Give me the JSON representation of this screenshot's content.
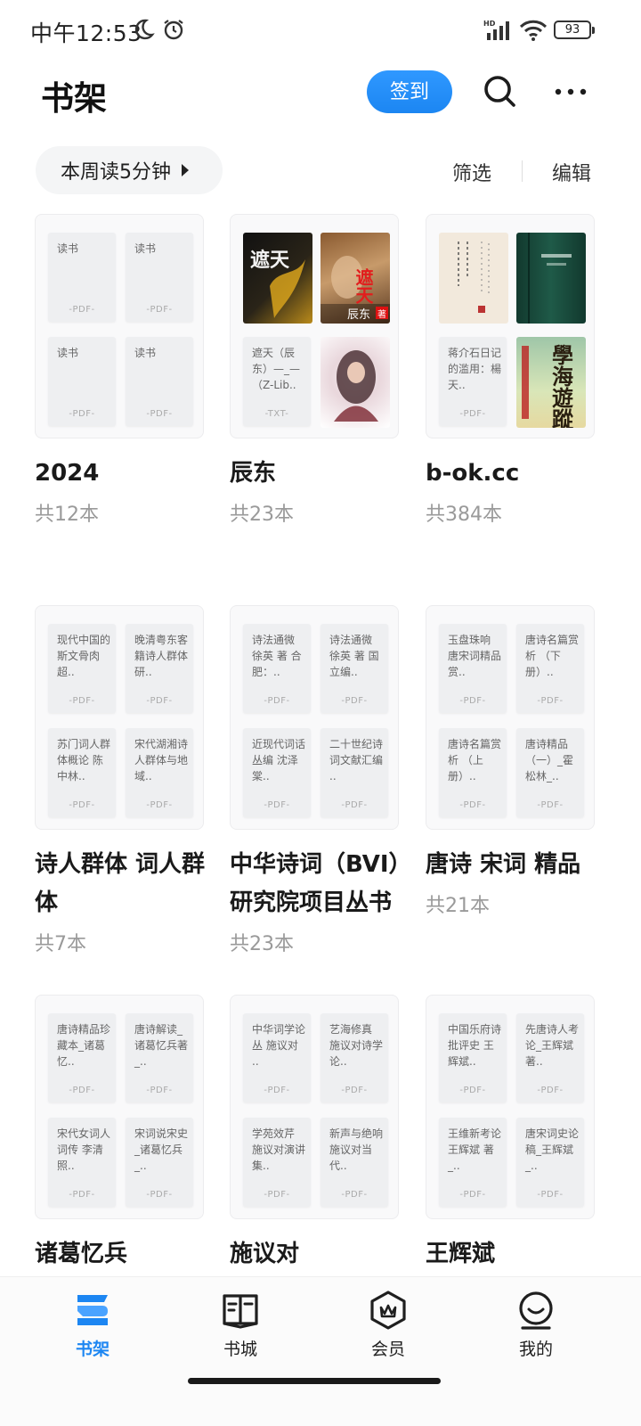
{
  "status_bar": {
    "time": "中午12:53",
    "battery": "93",
    "network_label": "HD"
  },
  "header": {
    "title": "书架",
    "signin_label": "签到"
  },
  "subheader": {
    "weekly_read": "本周读5分钟",
    "filter_label": "筛选",
    "edit_label": "编辑"
  },
  "folders": [
    {
      "name": "2024",
      "count": "共12本",
      "books": [
        {
          "title": "读书",
          "format": "-PDF-"
        },
        {
          "title": "读书",
          "format": "-PDF-"
        },
        {
          "title": "读书",
          "format": "-PDF-"
        },
        {
          "title": "读书",
          "format": "-PDF-"
        }
      ]
    },
    {
      "name": "辰东",
      "count": "共23本",
      "books": [
        {
          "title": "遮天",
          "format": ""
        },
        {
          "title": "遮天",
          "format": ""
        },
        {
          "title": "遮天（辰东）—_—（Z-Lib..",
          "format": "-TXT-"
        },
        {
          "title": "",
          "format": ""
        }
      ],
      "cover_text": {
        "c0": "遮天",
        "c1_title": "遮天",
        "c1_author": "辰东",
        "c1_badge": "著"
      }
    },
    {
      "name": "b-ok.cc",
      "count": "共384本",
      "books": [
        {
          "title": "",
          "format": ""
        },
        {
          "title": "",
          "format": ""
        },
        {
          "title": "蒋介石日记的滥用：楊天..",
          "format": "-PDF-"
        },
        {
          "title": "",
          "format": ""
        }
      ],
      "cover_text": {
        "c3": "學海遊蹤"
      }
    },
    {
      "name": "诗人群体 词人群体",
      "count": "共7本",
      "books": [
        {
          "title": "现代中国的斯文骨肉 超..",
          "format": "-PDF-"
        },
        {
          "title": "晚清粤东客籍诗人群体研..",
          "format": "-PDF-"
        },
        {
          "title": "苏门词人群体概论 陈中林..",
          "format": "-PDF-"
        },
        {
          "title": "宋代湖湘诗人群体与地域..",
          "format": "-PDF-"
        }
      ]
    },
    {
      "name": "中华诗词（BVI）研究院项目丛书",
      "count": "共23本",
      "books": [
        {
          "title": "诗法通微 徐英 著 合肥：..",
          "format": "-PDF-"
        },
        {
          "title": "诗法通微 徐英 著 国立编..",
          "format": "-PDF-"
        },
        {
          "title": "近现代词话丛编 沈泽棠..",
          "format": "-PDF-"
        },
        {
          "title": "二十世纪诗词文献汇编 ..",
          "format": "-PDF-"
        }
      ]
    },
    {
      "name": "唐诗 宋词 精品",
      "count": "共21本",
      "books": [
        {
          "title": "玉盘珠响 唐宋词精品赏..",
          "format": "-PDF-"
        },
        {
          "title": "唐诗名篇赏析 （下册）..",
          "format": "-PDF-"
        },
        {
          "title": "唐诗名篇赏析 （上册）..",
          "format": "-PDF-"
        },
        {
          "title": "唐诗精品（一）_霍松林_..",
          "format": "-PDF-"
        }
      ]
    },
    {
      "name": "诸葛忆兵",
      "count": "",
      "books": [
        {
          "title": "唐诗精品珍藏本_诸葛忆..",
          "format": "-PDF-"
        },
        {
          "title": "唐诗解读_诸葛忆兵著_..",
          "format": "-PDF-"
        },
        {
          "title": "宋代女词人词传 李清照..",
          "format": "-PDF-"
        },
        {
          "title": "宋词说宋史_诸葛忆兵_..",
          "format": "-PDF-"
        }
      ]
    },
    {
      "name": "施议对",
      "count": "",
      "books": [
        {
          "title": "中华词学论丛 施议对 ..",
          "format": "-PDF-"
        },
        {
          "title": "艺海修真 施议对诗学论..",
          "format": "-PDF-"
        },
        {
          "title": "学苑效芹 施议对演讲集..",
          "format": "-PDF-"
        },
        {
          "title": "新声与绝响 施议对当代..",
          "format": "-PDF-"
        }
      ]
    },
    {
      "name": "王辉斌",
      "count": "",
      "books": [
        {
          "title": "中国乐府诗批评史 王辉斌..",
          "format": "-PDF-"
        },
        {
          "title": "先唐诗人考论_王辉斌著..",
          "format": "-PDF-"
        },
        {
          "title": "王维新考论 王辉斌 著_..",
          "format": "-PDF-"
        },
        {
          "title": "唐宋词史论稿_王辉斌_..",
          "format": "-PDF-"
        }
      ]
    }
  ],
  "bottom_nav": [
    {
      "label": "书架",
      "icon": "bookshelf-icon"
    },
    {
      "label": "书城",
      "icon": "bookstore-icon"
    },
    {
      "label": "会员",
      "icon": "vip-icon"
    },
    {
      "label": "我的",
      "icon": "profile-icon"
    }
  ],
  "colors": {
    "accent": "#1c86f2",
    "text": "#1a1a1a",
    "muted": "#9a9a9a"
  }
}
